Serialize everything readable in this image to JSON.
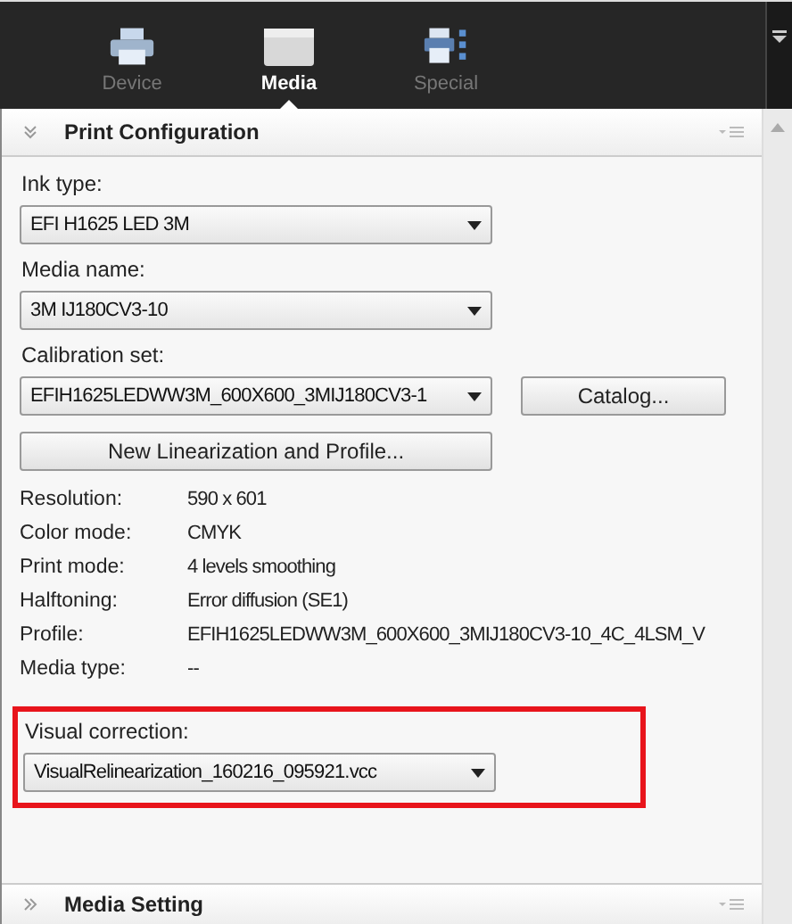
{
  "tabs": [
    {
      "label": "Device",
      "kind": "printer",
      "selected": false
    },
    {
      "label": "Media",
      "kind": "media",
      "selected": true
    },
    {
      "label": "Special",
      "kind": "special",
      "selected": false
    }
  ],
  "sections": [
    {
      "title": "Print Configuration",
      "expanded": true
    },
    {
      "title": "Media Setting",
      "expanded": false
    }
  ],
  "dropdowns": [
    {
      "label": "Ink type:",
      "value": "EFI H1625 LED 3M"
    },
    {
      "label": "Media name:",
      "value": "3M IJ180CV3-10"
    },
    {
      "label": "Calibration set:",
      "value": "EFIH1625LEDWW3M_600X600_3MIJ180CV3-1"
    }
  ],
  "catalog_button": "Catalog...",
  "new_button": "New Linearization and Profile...",
  "info": [
    {
      "label": "Resolution:",
      "value": "590 x 601"
    },
    {
      "label": "Color mode:",
      "value": "CMYK"
    },
    {
      "label": "Print mode:",
      "value": "4 levels smoothing"
    },
    {
      "label": "Halftoning:",
      "value": "Error diffusion (SE1)"
    },
    {
      "label": "Profile:",
      "value": "EFIH1625LEDWW3M_600X600_3MIJ180CV3-10_4C_4LSM_V"
    },
    {
      "label": "Media type:",
      "value": "--"
    }
  ],
  "visual_correction": {
    "label": "Visual correction:",
    "value": "VisualRelinearization_160216_095921.vcc",
    "highlighted": true
  }
}
